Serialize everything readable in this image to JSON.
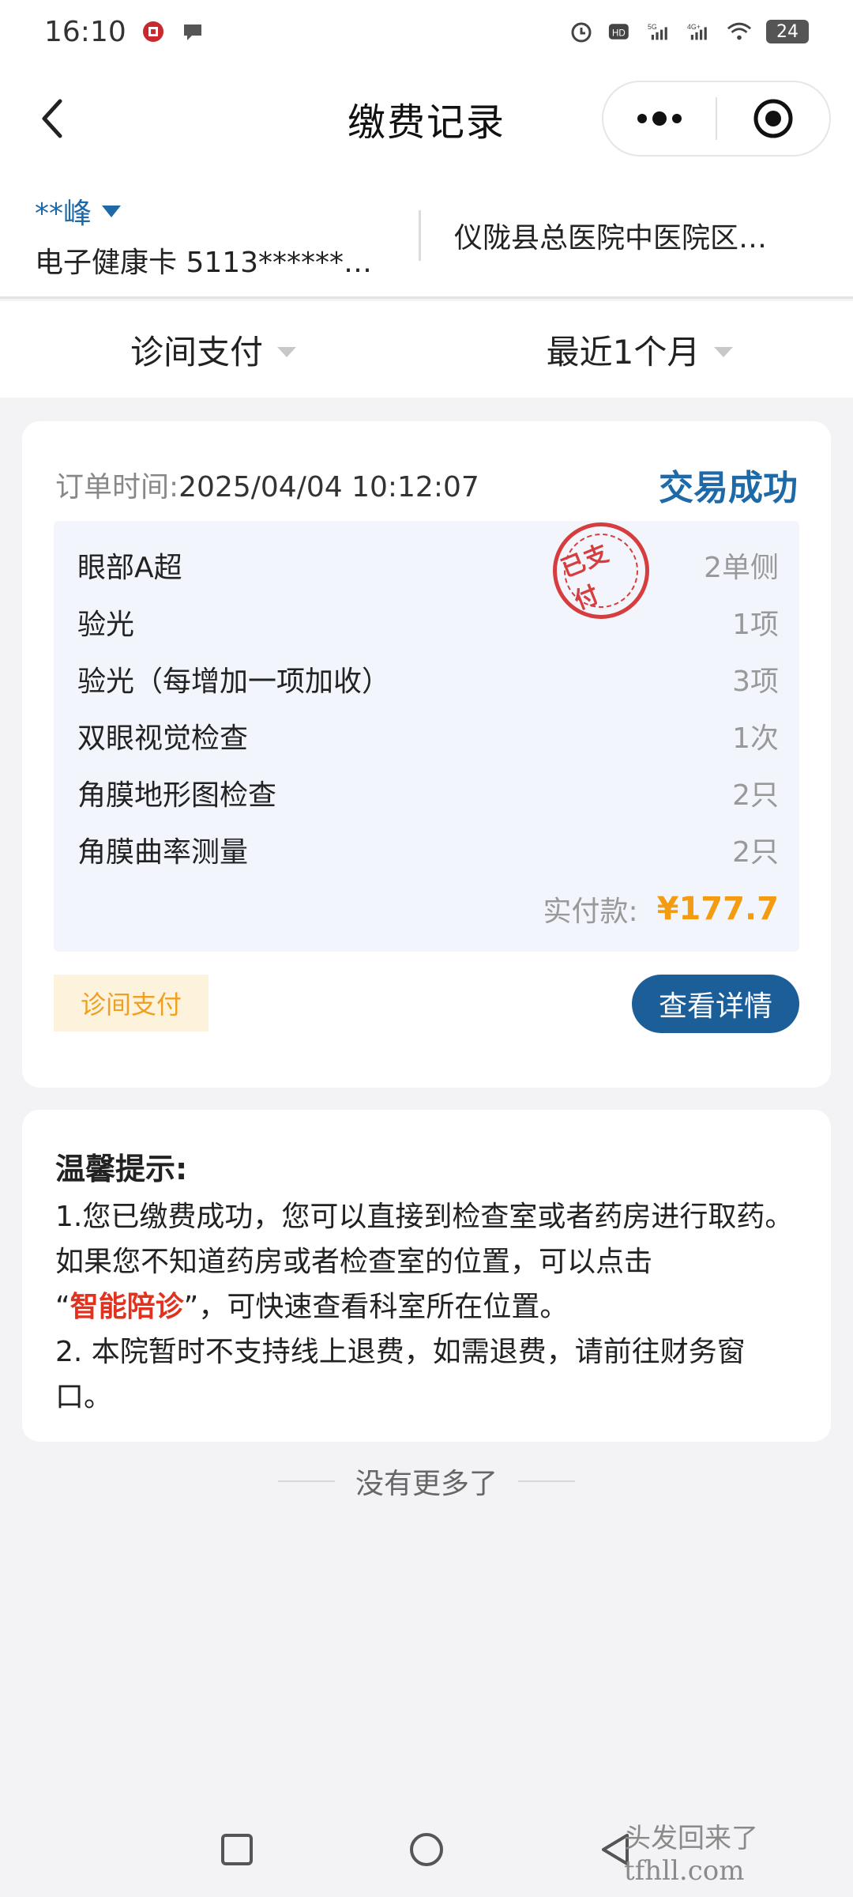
{
  "status_bar": {
    "time": "16:10",
    "battery": "24"
  },
  "header": {
    "title": "缴费记录"
  },
  "patient": {
    "name": "**峰",
    "card": "电子健康卡 5113******…",
    "hospital": "仪陇县总医院中医院区…"
  },
  "filters": {
    "type": "诊间支付",
    "period": "最近1个月"
  },
  "order": {
    "time_label": "订单时间:",
    "time": "2025/04/04 10:12:07",
    "status": "交易成功",
    "stamp": "已支付",
    "items": [
      {
        "name": "眼部A超",
        "qty": "2单侧"
      },
      {
        "name": "验光",
        "qty": "1项"
      },
      {
        "name": "验光（每增加一项加收）",
        "qty": "3项"
      },
      {
        "name": "双眼视觉检查",
        "qty": "1次"
      },
      {
        "name": "角膜地形图检查",
        "qty": "2只"
      },
      {
        "name": "角膜曲率测量",
        "qty": "2只"
      }
    ],
    "total_label": "实付款:",
    "total": "¥177.7",
    "tag": "诊间支付",
    "detail_button": "查看详情"
  },
  "tips": {
    "title": "温馨提示:",
    "line1_a": "1.您已缴费成功，您可以直接到检查室或者药房进行取药。如果您不知道药房或者检查室的位置，可以点击",
    "quote_open": "“",
    "highlight": "智能陪诊",
    "line1_b": "”，可快速查看科室所在位置。",
    "line2": "2. 本院暂时不支持线上退费，如需退费，请前往财务窗口。"
  },
  "end_text": "没有更多了",
  "watermark": "头发回来了 tfhll.com",
  "colors": {
    "primary": "#1e6aa8",
    "button": "#1c5f98",
    "amount": "#f39c12",
    "highlight": "#e0321f",
    "stamp": "#d42a2a"
  }
}
